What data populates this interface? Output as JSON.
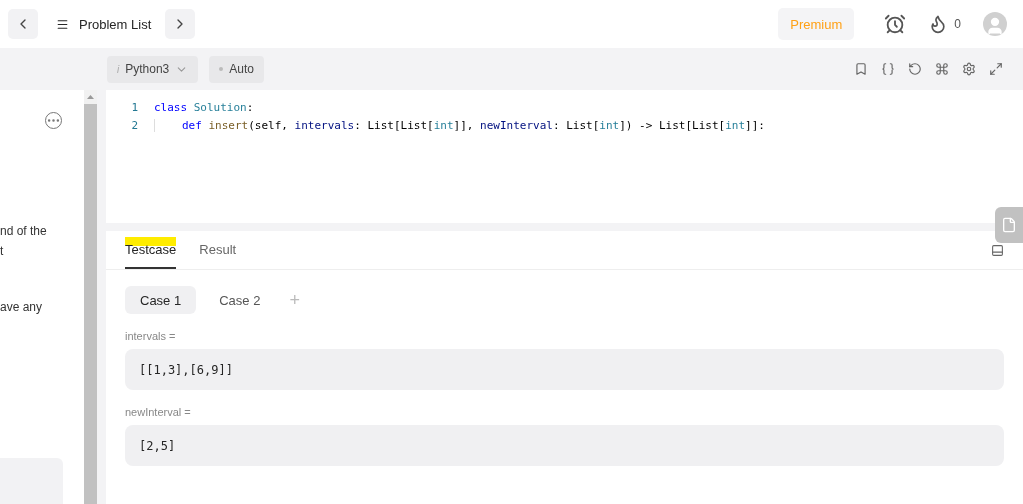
{
  "top_bar": {
    "title": "Problem List",
    "premium": "Premium",
    "streak": "0"
  },
  "editor_toolbar": {
    "language": "Python3",
    "language_hint": "i",
    "mode": "Auto"
  },
  "description": {
    "lines": [
      {
        "text": "nd of the"
      },
      {
        "text": "t"
      },
      {
        "text": "ave any"
      }
    ]
  },
  "code": {
    "lines": [
      {
        "number": "1",
        "indent": false,
        "tokens": [
          {
            "text": "class ",
            "kind": "keyword"
          },
          {
            "text": "Solution",
            "kind": "type"
          },
          {
            "text": ":",
            "kind": "plain"
          }
        ]
      },
      {
        "number": "2",
        "indent": true,
        "tokens": [
          {
            "text": "def ",
            "kind": "keyword"
          },
          {
            "text": "insert",
            "kind": "function"
          },
          {
            "text": "(self, ",
            "kind": "plain"
          },
          {
            "text": "intervals",
            "kind": "param"
          },
          {
            "text": ": List[List[",
            "kind": "plain"
          },
          {
            "text": "int",
            "kind": "type"
          },
          {
            "text": "]], ",
            "kind": "plain"
          },
          {
            "text": "newInterval",
            "kind": "param"
          },
          {
            "text": ": List[",
            "kind": "plain"
          },
          {
            "text": "int",
            "kind": "type"
          },
          {
            "text": "]) -> List[List[",
            "kind": "plain"
          },
          {
            "text": "int",
            "kind": "type"
          },
          {
            "text": "]]:",
            "kind": "plain"
          }
        ]
      }
    ]
  },
  "testcase_tabs": [
    {
      "label": "Testcase",
      "selected": true,
      "highlighted": true
    },
    {
      "label": "Result",
      "selected": false,
      "highlighted": false
    }
  ],
  "cases": [
    {
      "label": "Case 1",
      "selected": true
    },
    {
      "label": "Case 2",
      "selected": false
    }
  ],
  "add_case": "+",
  "inputs": [
    {
      "label": "intervals =",
      "value": "[[1,3],[6,9]]"
    },
    {
      "label": "newInterval =",
      "value": "[2,5]"
    }
  ]
}
